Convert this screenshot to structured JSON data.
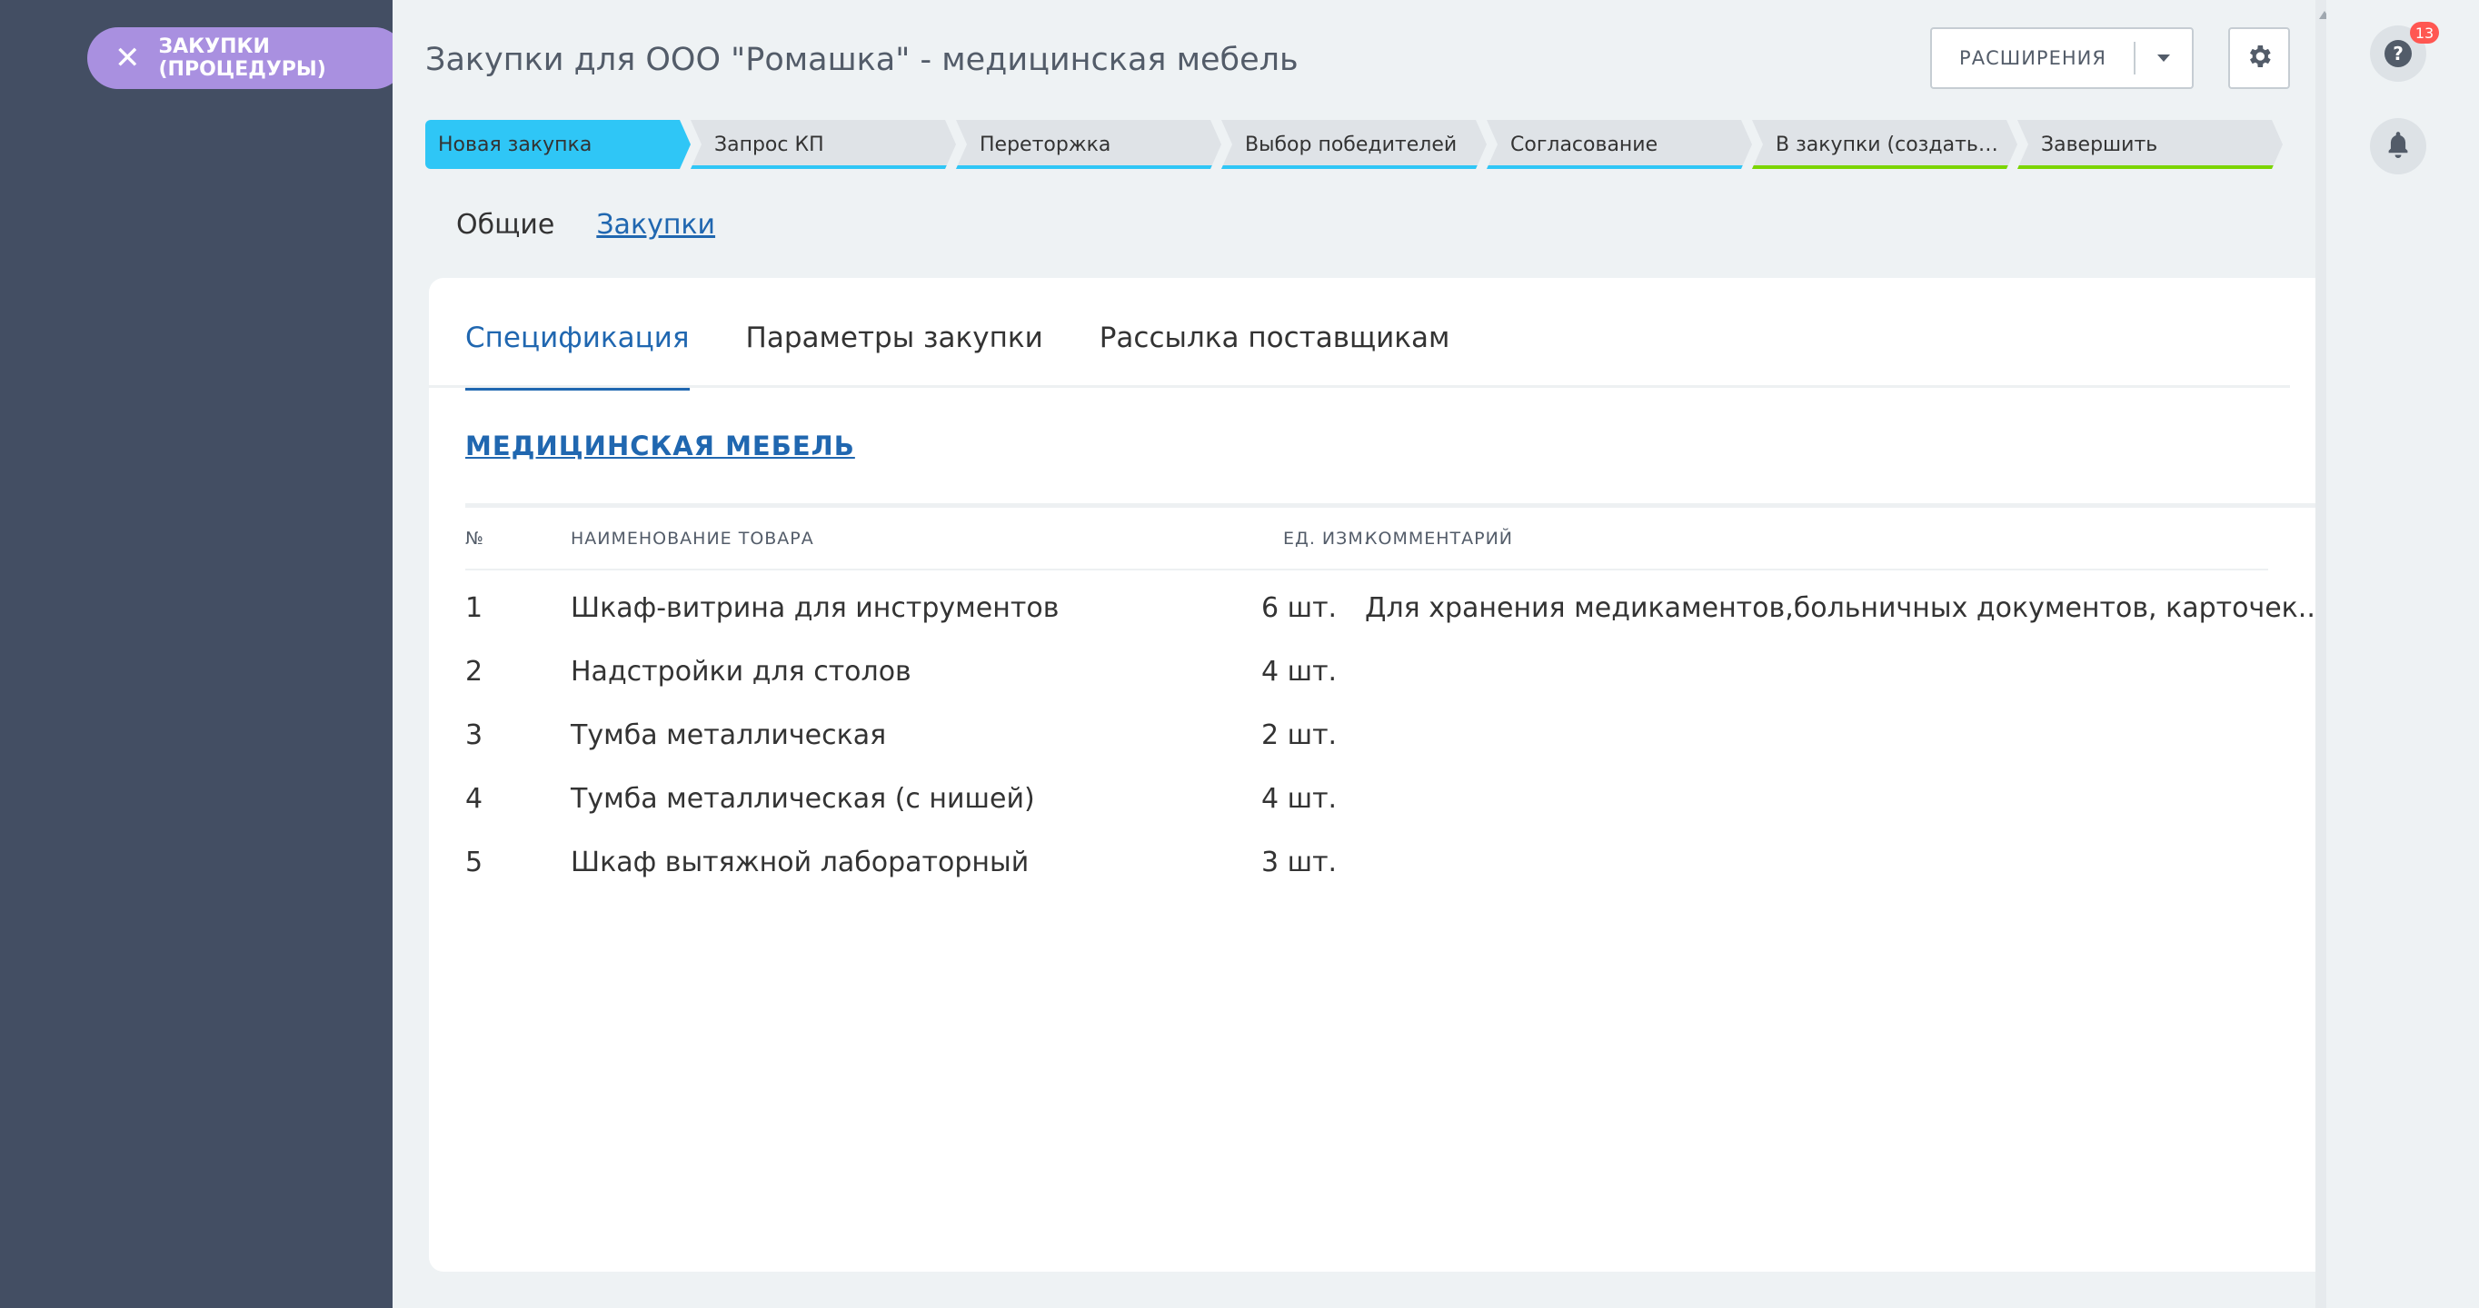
{
  "panel": {
    "close_label": "ЗАКУПКИ (ПРОЦЕДУРЫ)"
  },
  "header": {
    "title": "Закупки для ООО \"Ромашка\" - медицинская мебель",
    "extensions_label": "РАСШИРЕНИЯ"
  },
  "stages": [
    {
      "label": "Новая закупка",
      "active": true,
      "bar_color": "#2fc6f6"
    },
    {
      "label": "Запрос КП",
      "active": false,
      "bar_color": "#2fc6f6"
    },
    {
      "label": "Переторжка",
      "active": false,
      "bar_color": "#2fc6f6"
    },
    {
      "label": "Выбор победителей",
      "active": false,
      "bar_color": "#2fc6f6"
    },
    {
      "label": "Согласование",
      "active": false,
      "bar_color": "#2fc6f6"
    },
    {
      "label": "В закупки (создать сде...",
      "active": false,
      "bar_color": "#7bd500"
    },
    {
      "label": "Завершить",
      "active": false,
      "bar_color": "#7bd500"
    }
  ],
  "top_tabs": {
    "general": "Общие",
    "purchases": "Закупки"
  },
  "card": {
    "tabs": [
      "Спецификация",
      "Параметры закупки",
      "Рассылка поставщикам"
    ],
    "section_title": "МЕДИЦИНСКАЯ МЕБЕЛЬ",
    "columns": {
      "num": "№",
      "name": "НАИМЕНОВАНИЕ ТОВАРА",
      "unit": "ЕД. ИЗМ.",
      "comment": "КОММЕНТАРИЙ"
    },
    "rows": [
      {
        "num": "1",
        "name": "Шкаф-витрина для инструментов",
        "qty": "6 шт.",
        "comment": "Для хранения медикаментов,больничных документов, карточек..."
      },
      {
        "num": "2",
        "name": "Надстройки для столов",
        "qty": "4 шт.",
        "comment": ""
      },
      {
        "num": "3",
        "name": "Тумба металлическая",
        "qty": "2 шт.",
        "comment": ""
      },
      {
        "num": "4",
        "name": "Тумба металлическая (с нишей)",
        "qty": "4 шт.",
        "comment": ""
      },
      {
        "num": "5",
        "name": "Шкаф вытяжной лабораторный",
        "qty": "3 шт.",
        "comment": ""
      }
    ]
  },
  "right_rail": {
    "help_icon": "?",
    "notifications_count": "13"
  },
  "colors": {
    "accent": "#2067b0",
    "active_stage": "#2fc6f6",
    "pill": "#a990e0",
    "panel": "#434e63"
  }
}
